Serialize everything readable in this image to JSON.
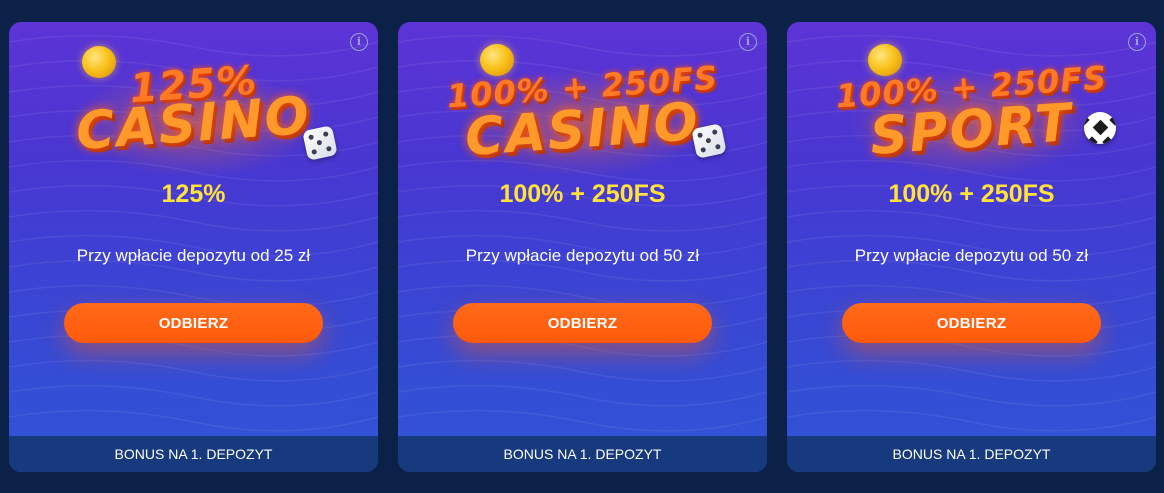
{
  "cards": [
    {
      "logo_top": "125%",
      "logo_main": "CASINO",
      "logo_extra": "dice",
      "amount": "125%",
      "description": "Przy wpłacie depozytu od 25 zł",
      "button_label": "ODBIERZ",
      "footer_label": "BONUS NA 1. DEPOZYT",
      "info_icon": "i"
    },
    {
      "logo_top": "100% + 250FS",
      "logo_main": "CASINO",
      "logo_extra": "dice",
      "amount": "100% + 250FS",
      "description": "Przy wpłacie depozytu od 50 zł",
      "button_label": "ODBIERZ",
      "footer_label": "BONUS NA 1. DEPOZYT",
      "info_icon": "i"
    },
    {
      "logo_top": "100% + 250FS",
      "logo_main": "SPORT",
      "logo_extra": "soccer-ball",
      "amount": "100% + 250FS",
      "description": "Przy wpłacie depozytu od 50 zł",
      "button_label": "ODBIERZ",
      "footer_label": "BONUS NA 1. DEPOZYT",
      "info_icon": "i"
    }
  ],
  "colors": {
    "page_background": "#0c2148",
    "card_gradient_top": "#5d34d6",
    "card_gradient_bottom": "#2f55d6",
    "amount_text": "#ffe23a",
    "button": "#ff5a0a",
    "footer": "#163a7d",
    "logo_orange": "#ff8a24"
  }
}
